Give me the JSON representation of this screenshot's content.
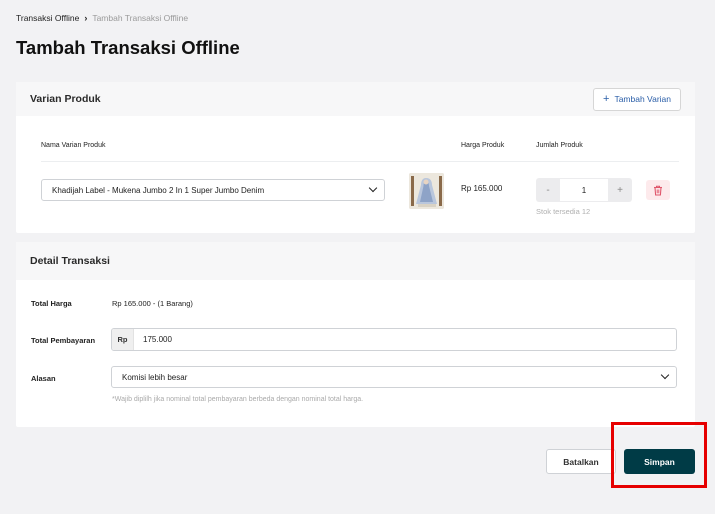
{
  "breadcrumb": {
    "home": "Transaksi Offline",
    "current": "Tambah Transaksi Offline"
  },
  "page_title": "Tambah Transaksi Offline",
  "varian": {
    "title": "Varian Produk",
    "add_button": "Tambah Varian",
    "columns": {
      "name": "Nama Varian Produk",
      "price": "Harga Produk",
      "qty": "Jumlah Produk"
    },
    "item": {
      "product_name": "Khadijah Label - Mukena Jumbo 2 In 1 Super Jumbo Denim",
      "price": "Rp 165.000",
      "minus": "-",
      "quantity": "1",
      "plus": "+",
      "stock": "Stok tersedia 12"
    }
  },
  "detail": {
    "title": "Detail Transaksi",
    "total_harga_label": "Total Harga",
    "total_harga_value": "Rp 165.000  - (1 Barang)",
    "total_pembayaran_label": "Total Pembayaran",
    "currency_prefix": "Rp",
    "total_pembayaran_value": "175.000",
    "alasan_label": "Alasan",
    "alasan_value": "Komisi lebih besar",
    "hint": "*Wajib diplilh jika nominal total pembayaran berbeda dengan nominal total harga."
  },
  "actions": {
    "cancel": "Batalkan",
    "save": "Simpan"
  },
  "colors": {
    "primary": "#003b46",
    "link": "#2a5ea8",
    "danger": "#e0566b",
    "highlight": "#e60000"
  }
}
